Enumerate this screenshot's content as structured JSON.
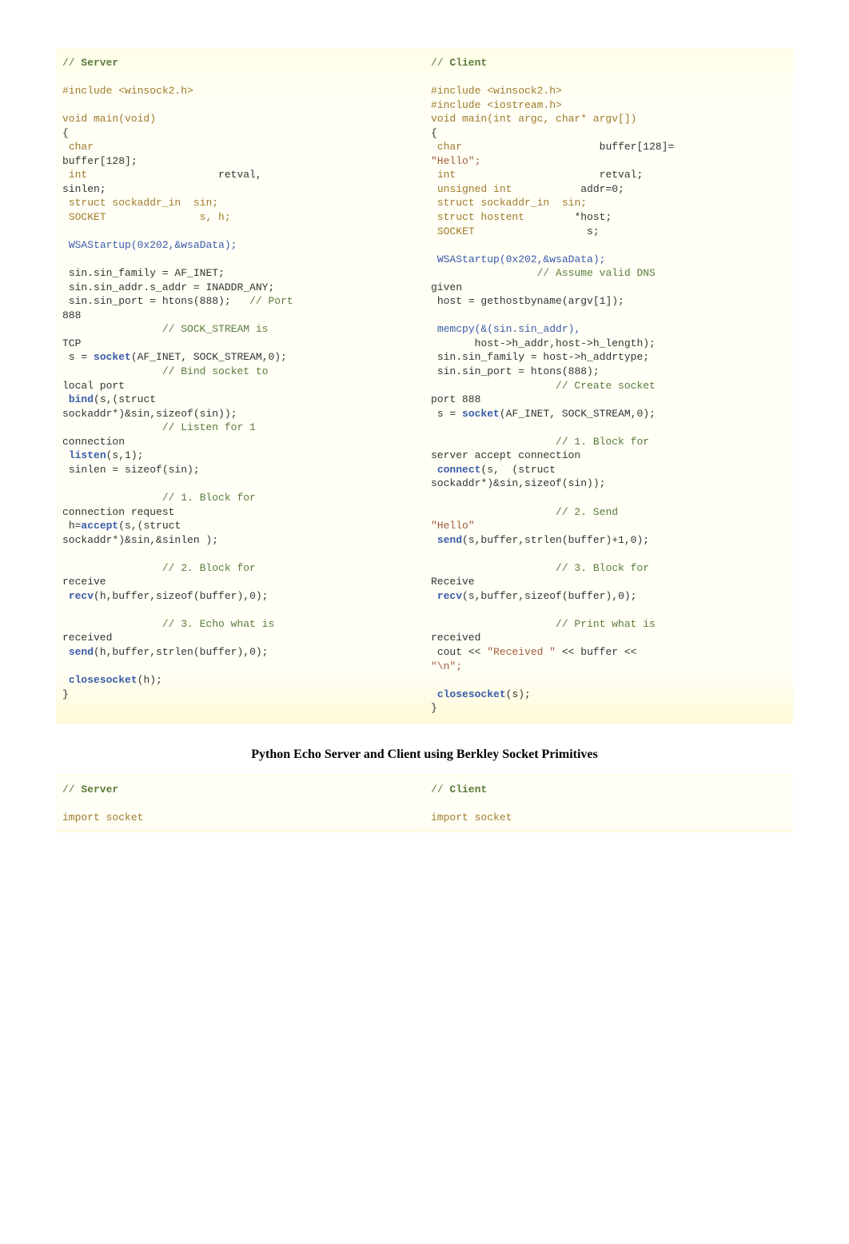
{
  "section1": {
    "server_label": "Server",
    "client_label": "Client",
    "server_lines": [
      {
        "t": "comment",
        "s": "// "
      },
      {
        "t": "blank"
      },
      {
        "t": "include",
        "s": "#include <winsock2.h>"
      },
      {
        "t": "blank"
      },
      {
        "t": "decl",
        "s": "void main(void)"
      },
      {
        "t": "plain",
        "s": "{"
      },
      {
        "t": "type2",
        "a": " char",
        "b": "                         ",
        "c": ""
      },
      {
        "t": "plain",
        "s": "buffer[128];"
      },
      {
        "t": "type2",
        "a": " int",
        "b": "                     retval, ",
        "c": ""
      },
      {
        "t": "plain",
        "s": "sinlen;"
      },
      {
        "t": "type2",
        "a": " struct sockaddr_in  sin;",
        "b": "",
        "c": ""
      },
      {
        "t": "type2",
        "a": " SOCKET               s, h;",
        "b": "",
        "c": ""
      },
      {
        "t": "blank"
      },
      {
        "t": "call",
        "s": " WSAStartup(0x202,&wsaData);"
      },
      {
        "t": "blank"
      },
      {
        "t": "assign",
        "s": " sin.sin_family = AF_INET;"
      },
      {
        "t": "assign",
        "s": " sin.sin_addr.s_addr = INADDR_ANY;"
      },
      {
        "t": "assign_c",
        "s": " sin.sin_port = htons(888);   ",
        "c": "// Port"
      },
      {
        "t": "plain",
        "s": "888"
      },
      {
        "t": "comment_only",
        "s": "                // SOCK_STREAM is "
      },
      {
        "t": "plain",
        "s": "TCP"
      },
      {
        "t": "sock",
        "a": " s = ",
        "b": "socket",
        "c": "(AF_INET, SOCK_STREAM,0);"
      },
      {
        "t": "comment_only",
        "s": "                // Bind socket to "
      },
      {
        "t": "plain",
        "s": "local port"
      },
      {
        "t": "boldcall",
        "a": " ",
        "b": "bind",
        "c": "(s,(struct "
      },
      {
        "t": "plain",
        "s": "sockaddr*)&sin,sizeof(sin));"
      },
      {
        "t": "comment_only",
        "s": "                // Listen for 1 "
      },
      {
        "t": "plain",
        "s": "connection"
      },
      {
        "t": "boldcall",
        "a": " ",
        "b": "listen",
        "c": "(s,1);"
      },
      {
        "t": "assign",
        "s": " sinlen = sizeof(sin);"
      },
      {
        "t": "blank"
      },
      {
        "t": "comment_only",
        "s": "                // 1. Block for "
      },
      {
        "t": "plain",
        "s": "connection request"
      },
      {
        "t": "boldcall",
        "a": " h=",
        "b": "accept",
        "c": "(s,(struct "
      },
      {
        "t": "plain",
        "s": "sockaddr*)&sin,&sinlen );"
      },
      {
        "t": "blank"
      },
      {
        "t": "comment_only",
        "s": "                // 2. Block for "
      },
      {
        "t": "plain",
        "s": "receive"
      },
      {
        "t": "boldcall",
        "a": " ",
        "b": "recv",
        "c": "(h,buffer,sizeof(buffer),0);"
      },
      {
        "t": "blank"
      },
      {
        "t": "comment_only",
        "s": "                // 3. Echo what is "
      },
      {
        "t": "plain",
        "s": "received"
      },
      {
        "t": "boldcall",
        "a": " ",
        "b": "send",
        "c": "(h,buffer,strlen(buffer),0);"
      },
      {
        "t": "blank"
      },
      {
        "t": "boldcall",
        "a": " ",
        "b": "closesocket",
        "c": "(h);"
      },
      {
        "t": "plain",
        "s": "}"
      }
    ],
    "client_lines": [
      {
        "t": "comment",
        "s": "// "
      },
      {
        "t": "blank"
      },
      {
        "t": "include",
        "s": "#include <winsock2.h>"
      },
      {
        "t": "include",
        "s": "#include <iostream.h>"
      },
      {
        "t": "decl",
        "s": "void main(int argc, char* argv[])"
      },
      {
        "t": "plain",
        "s": "{"
      },
      {
        "t": "type2",
        "a": " char",
        "b": "                      buffer[128]= ",
        "c": ""
      },
      {
        "t": "str",
        "s": "\"Hello\";"
      },
      {
        "t": "type2",
        "a": " int",
        "b": "                       retval;",
        "c": ""
      },
      {
        "t": "type2",
        "a": " unsigned int",
        "b": "           addr=0;",
        "c": ""
      },
      {
        "t": "type2",
        "a": " struct sockaddr_in  sin;",
        "b": "",
        "c": ""
      },
      {
        "t": "type2",
        "a": " struct hostent",
        "b": "        *host;",
        "c": ""
      },
      {
        "t": "type2",
        "a": " SOCKET",
        "b": "                  s;",
        "c": ""
      },
      {
        "t": "blank"
      },
      {
        "t": "call",
        "s": " WSAStartup(0x202,&wsaData);"
      },
      {
        "t": "comment_only",
        "s": "                 // Assume valid DNS "
      },
      {
        "t": "plain",
        "s": "given"
      },
      {
        "t": "assign",
        "s": " host = gethostbyname(argv[1]);"
      },
      {
        "t": "blank"
      },
      {
        "t": "call",
        "s": " memcpy(&(sin.sin_addr),"
      },
      {
        "t": "plain",
        "s": "       host->h_addr,host->h_length);"
      },
      {
        "t": "assign",
        "s": " sin.sin_family = host->h_addrtype;"
      },
      {
        "t": "assign",
        "s": " sin.sin_port = htons(888);"
      },
      {
        "t": "comment_only",
        "s": "                    // Create socket "
      },
      {
        "t": "plain",
        "s": "port 888"
      },
      {
        "t": "sock",
        "a": " s = ",
        "b": "socket",
        "c": "(AF_INET, SOCK_STREAM,0);"
      },
      {
        "t": "blank"
      },
      {
        "t": "comment_only",
        "s": "                    // 1. Block for "
      },
      {
        "t": "plain",
        "s": "server accept connection"
      },
      {
        "t": "boldcall",
        "a": " ",
        "b": "connect",
        "c": "(s,  (struct "
      },
      {
        "t": "plain",
        "s": "sockaddr*)&sin,sizeof(sin));"
      },
      {
        "t": "blank"
      },
      {
        "t": "comment_only",
        "s": "                    // 2. Send "
      },
      {
        "t": "str",
        "s": "\"Hello\""
      },
      {
        "t": "boldcall",
        "a": " ",
        "b": "send",
        "c": "(s,buffer,strlen(buffer)+1,0);"
      },
      {
        "t": "blank"
      },
      {
        "t": "comment_only",
        "s": "                    // 3. Block for "
      },
      {
        "t": "plain",
        "s": "Receive"
      },
      {
        "t": "boldcall",
        "a": " ",
        "b": "recv",
        "c": "(s,buffer,sizeof(buffer),0);"
      },
      {
        "t": "blank"
      },
      {
        "t": "comment_only",
        "s": "                    // Print what is "
      },
      {
        "t": "plain",
        "s": "received"
      },
      {
        "t": "cout",
        "a": " cout << ",
        "b": "\"Received \"",
        "c": " << buffer << "
      },
      {
        "t": "str",
        "s": "\"\\n\";"
      },
      {
        "t": "blank"
      },
      {
        "t": "boldcall",
        "a": " ",
        "b": "closesocket",
        "c": "(s);"
      },
      {
        "t": "plain",
        "s": "}"
      }
    ]
  },
  "section2": {
    "title": "Python Echo Server and Client using Berkley Socket Primitives",
    "server_label": "Server",
    "client_label": "Client",
    "server_lines": [
      {
        "t": "comment",
        "s": "// "
      },
      {
        "t": "blank"
      },
      {
        "t": "import",
        "s": "import socket"
      }
    ],
    "client_lines": [
      {
        "t": "comment",
        "s": "// "
      },
      {
        "t": "blank"
      },
      {
        "t": "import",
        "s": "import socket"
      }
    ]
  }
}
